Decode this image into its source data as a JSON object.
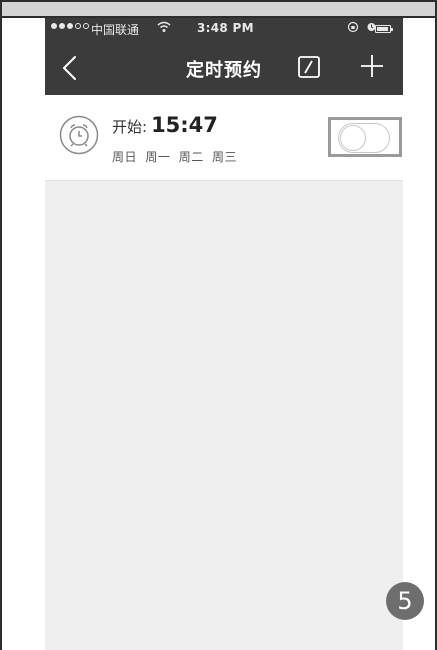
{
  "status_bar": {
    "carrier": "中国联通",
    "time": "3:48 PM"
  },
  "nav": {
    "title": "定时预约"
  },
  "schedule": {
    "start_label": "开始:",
    "start_time": "15:47",
    "repeat_days": [
      "周日",
      "周一",
      "周二",
      "周三"
    ],
    "enabled": false
  },
  "badge": {
    "step": "5"
  },
  "colors": {
    "header_bg": "#3b3b3b",
    "screen_bg": "#efefef",
    "row_bg": "#ffffff",
    "badge_bg": "#6e6e6e"
  },
  "icons": {
    "back": "chevron-left-icon",
    "edit": "edit-icon",
    "add": "plus-icon",
    "schedule": "alarm-clock-icon"
  }
}
